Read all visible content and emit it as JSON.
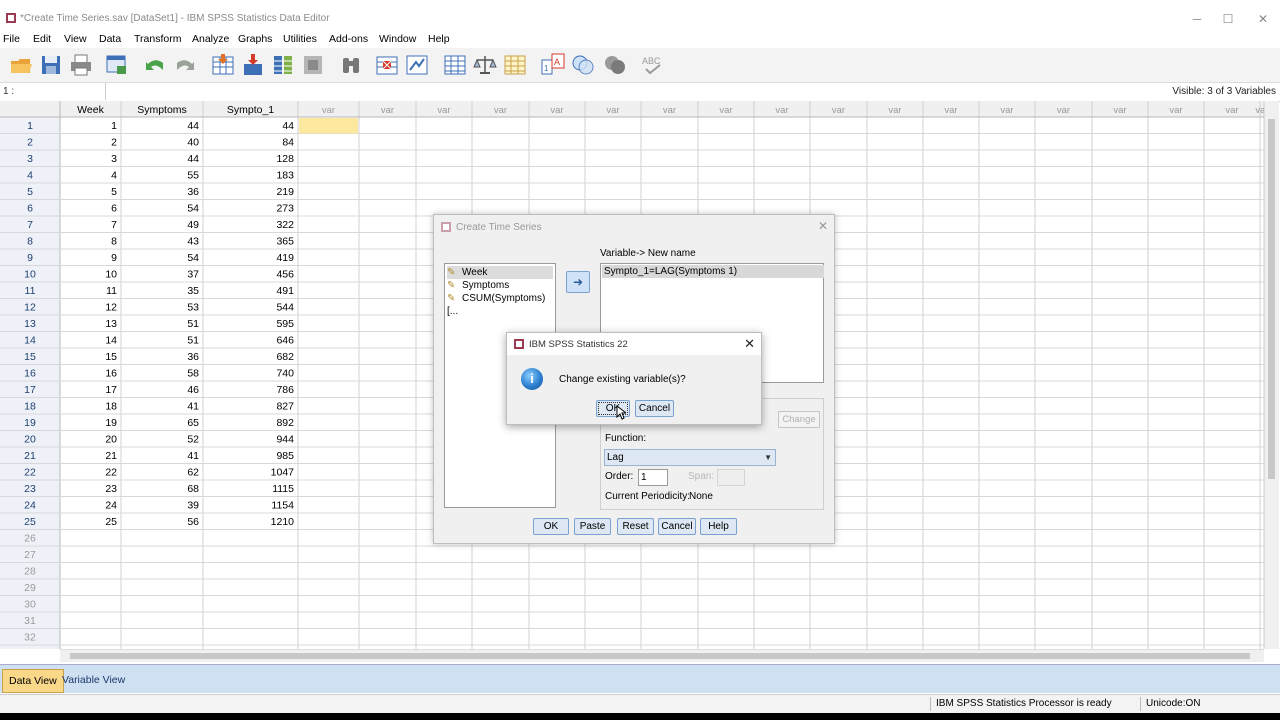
{
  "window": {
    "title": "*Create Time Series.sav [DataSet1] - IBM SPSS Statistics Data Editor",
    "controls": [
      "─",
      "☐",
      "✕"
    ]
  },
  "menubar": [
    "File",
    "Edit",
    "View",
    "Data",
    "Transform",
    "Analyze",
    "Graphs",
    "Utilities",
    "Add-ons",
    "Window",
    "Help"
  ],
  "toolbar": [
    "open-icon",
    "save-icon",
    "print-icon",
    "recall-dialog-icon",
    "undo-icon",
    "redo-icon",
    "goto-case-icon",
    "goto-variable-icon",
    "variables-icon",
    "run-descriptives-icon",
    "find-icon",
    "insert-cases-icon",
    "insert-variable-icon",
    "split-file-icon",
    "weight-cases-icon",
    "select-cases-icon",
    "value-labels-icon",
    "use-variable-sets-icon",
    "show-all-variables-icon",
    "spelling-icon"
  ],
  "cellbar": {
    "ref": "1 :",
    "visible": "Visible: 3 of 3 Variables"
  },
  "grid": {
    "columns": [
      "Week",
      "Symptoms",
      "Sympto_1",
      "var",
      "var",
      "var",
      "var",
      "var",
      "var",
      "var",
      "var",
      "var",
      "var",
      "var",
      "var",
      "var",
      "var",
      "var",
      "var",
      "var",
      "var"
    ],
    "rows": [
      [
        "1",
        "1",
        "44",
        "44"
      ],
      [
        "2",
        "2",
        "40",
        "84"
      ],
      [
        "3",
        "3",
        "44",
        "128"
      ],
      [
        "4",
        "4",
        "55",
        "183"
      ],
      [
        "5",
        "5",
        "36",
        "219"
      ],
      [
        "6",
        "6",
        "54",
        "273"
      ],
      [
        "7",
        "7",
        "49",
        "322"
      ],
      [
        "8",
        "8",
        "43",
        "365"
      ],
      [
        "9",
        "9",
        "54",
        "419"
      ],
      [
        "10",
        "10",
        "37",
        "456"
      ],
      [
        "11",
        "11",
        "35",
        "491"
      ],
      [
        "12",
        "12",
        "53",
        "544"
      ],
      [
        "13",
        "13",
        "51",
        "595"
      ],
      [
        "14",
        "14",
        "51",
        "646"
      ],
      [
        "15",
        "15",
        "36",
        "682"
      ],
      [
        "16",
        "16",
        "58",
        "740"
      ],
      [
        "17",
        "17",
        "46",
        "786"
      ],
      [
        "18",
        "18",
        "41",
        "827"
      ],
      [
        "19",
        "19",
        "65",
        "892"
      ],
      [
        "20",
        "20",
        "52",
        "944"
      ],
      [
        "21",
        "21",
        "41",
        "985"
      ],
      [
        "22",
        "22",
        "62",
        "1047"
      ],
      [
        "23",
        "23",
        "68",
        "1115"
      ],
      [
        "24",
        "24",
        "39",
        "1154"
      ],
      [
        "25",
        "25",
        "56",
        "1210"
      ],
      [
        "26",
        "",
        "",
        ""
      ],
      [
        "27",
        "",
        "",
        ""
      ],
      [
        "28",
        "",
        "",
        ""
      ],
      [
        "29",
        "",
        "",
        ""
      ],
      [
        "30",
        "",
        "",
        ""
      ],
      [
        "31",
        "",
        "",
        ""
      ],
      [
        "32",
        "",
        "",
        ""
      ]
    ]
  },
  "tabs": {
    "data_view": "Data View",
    "variable_view": "Variable View"
  },
  "status": {
    "processor": "IBM SPSS Statistics Processor is ready",
    "unicode": "Unicode:ON"
  },
  "create_time_series": {
    "title": "Create Time Series",
    "source_vars": [
      "Week",
      "Symptoms",
      "CSUM(Symptoms) [..."
    ],
    "arrow": "➜",
    "new_name_label": "Variable-> New name",
    "new_name_items": [
      "Sympto_1=LAG(Symptoms 1)"
    ],
    "change_label": "Change",
    "function_label": "Function:",
    "function_value": "Lag",
    "order_label": "Order:",
    "order_value": "1",
    "span_label": "Span:",
    "periodicity_label": "Current Periodicity:",
    "periodicity_value": "None",
    "buttons": [
      "OK",
      "Paste",
      "Reset",
      "Cancel",
      "Help"
    ]
  },
  "message_box": {
    "title": "IBM SPSS Statistics 22",
    "text": "Change existing variable(s)?",
    "ok": "OK",
    "cancel": "Cancel",
    "close": "✕"
  }
}
